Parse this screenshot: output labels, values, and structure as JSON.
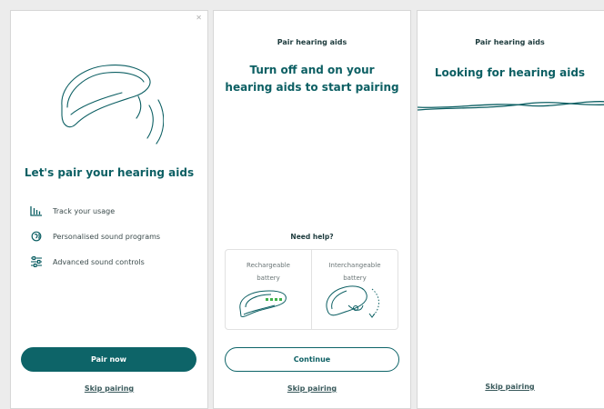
{
  "colors": {
    "brand": "#0d6468",
    "text_dark": "#1d3b3d",
    "link": "#3a5a5c",
    "charge_dots": "#3fb24a"
  },
  "screen1": {
    "illustration": "hearing-aid-sound-icon",
    "headline": "Let's pair your hearing aids",
    "features": [
      {
        "icon": "bar-chart-icon",
        "label": "Track your usage"
      },
      {
        "icon": "ear-sound-icon",
        "label": "Personalised sound programs"
      },
      {
        "icon": "sliders-icon",
        "label": "Advanced sound controls"
      }
    ],
    "primary_button": "Pair now",
    "skip_link": "Skip pairing"
  },
  "screen2": {
    "title": "Pair hearing aids",
    "headline": "Turn off and on your hearing aids to start pairing",
    "help_label": "Need help?",
    "options": [
      {
        "label": "Rechargeable battery",
        "icon": "rechargeable-hearing-aid-icon"
      },
      {
        "label": "Interchangeable battery",
        "icon": "battery-door-hearing-aid-icon"
      }
    ],
    "continue_button": "Continue",
    "skip_link": "Skip pairing"
  },
  "screen3": {
    "title": "Pair hearing aids",
    "headline": "Looking for hearing aids",
    "indicator": "searching-wave-icon",
    "skip_link": "Skip pairing"
  }
}
